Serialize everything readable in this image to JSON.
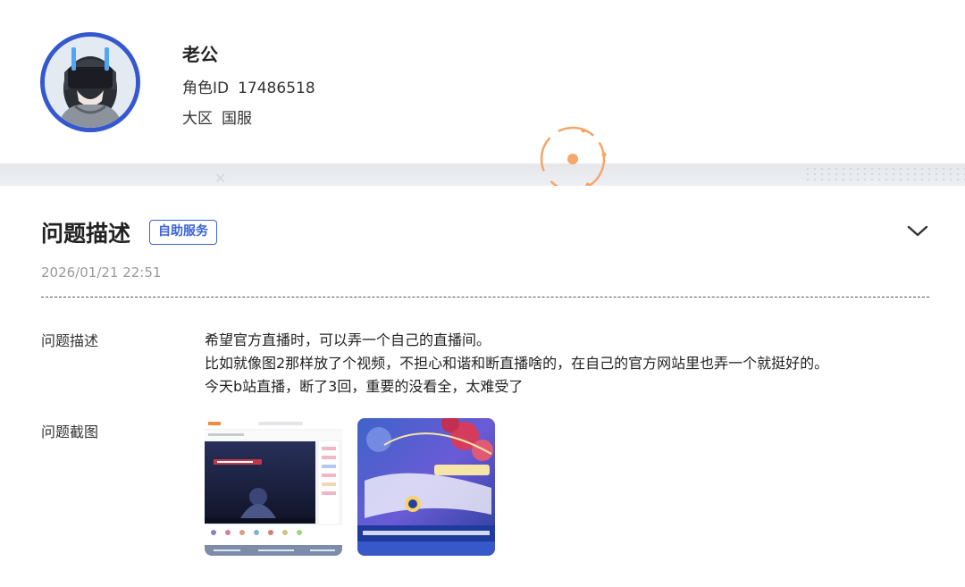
{
  "profile": {
    "name": "老公",
    "role_id_label": "角色ID",
    "role_id_value": "17486518",
    "region_label": "大区",
    "region_value": "国服"
  },
  "issue": {
    "title": "问题描述",
    "badge": "自助服务",
    "date": "2026/01/21 22:51",
    "description_label": "问题描述",
    "description_lines": [
      "希望官方直播时，可以弄一个自己的直播间。",
      "比如就像图2那样放了个视频，不担心和谐和断直播啥的，在自己的官方网站里也弄一个就挺好的。",
      "今天b站直播，断了3回，重要的没看全，太难受了"
    ],
    "screenshot_label": "问题截图",
    "screenshots": [
      "screenshot-1",
      "screenshot-2"
    ]
  },
  "colors": {
    "accent": "#3b63d8",
    "avatar_ring": "#3558cf",
    "decor_orange": "#f5a66a",
    "date_gray": "#999999"
  },
  "icons": {
    "expand": "chevron-down-icon"
  }
}
